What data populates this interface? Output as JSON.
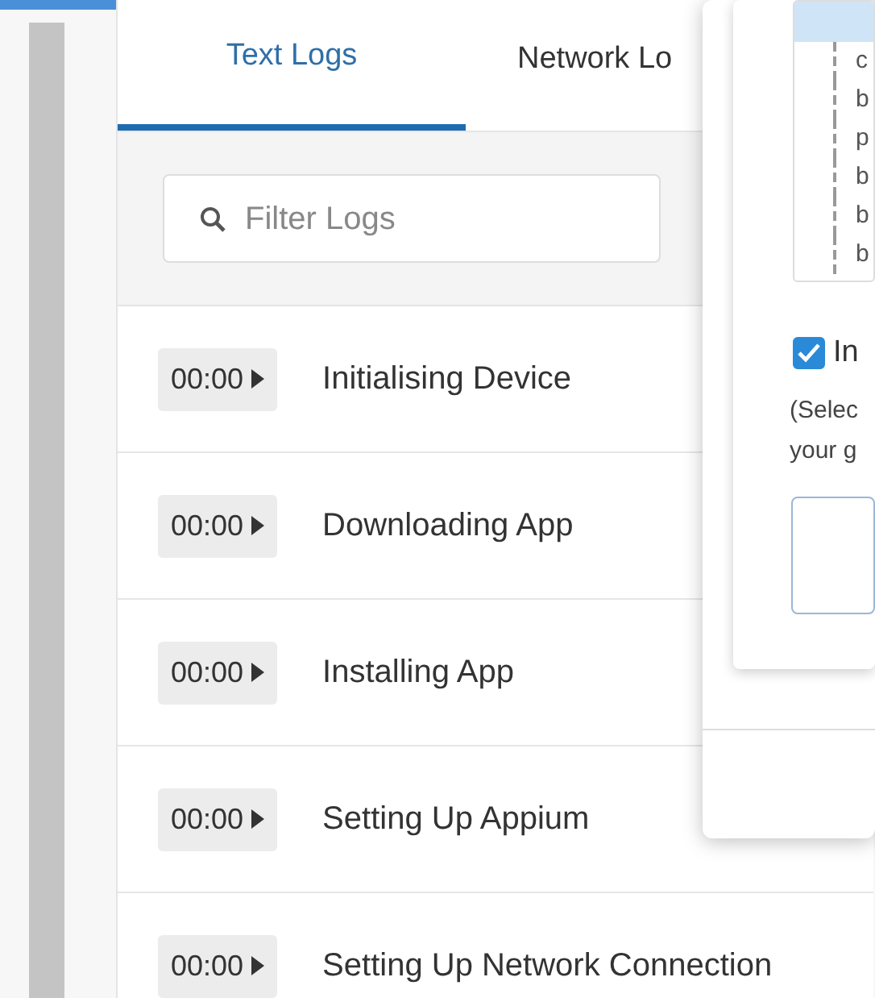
{
  "tabs": [
    {
      "label": "Text Logs",
      "selected": true
    },
    {
      "label": "Network Lo",
      "selected": false
    }
  ],
  "filter": {
    "placeholder": "Filter Logs"
  },
  "log_entries": [
    {
      "time": "00:00",
      "message": "Initialising Device"
    },
    {
      "time": "00:00",
      "message": "Downloading App"
    },
    {
      "time": "00:00",
      "message": "Installing App"
    },
    {
      "time": "00:00",
      "message": "Setting Up Appium"
    },
    {
      "time": "00:00",
      "message": "Setting Up Network Connection"
    }
  ],
  "dialog": {
    "log_lines": [
      "c",
      "b",
      "p",
      "b",
      "b",
      "b"
    ],
    "include_option": {
      "label": "In",
      "checked": true
    },
    "hint_lines": [
      "(Selec",
      "your g"
    ]
  }
}
